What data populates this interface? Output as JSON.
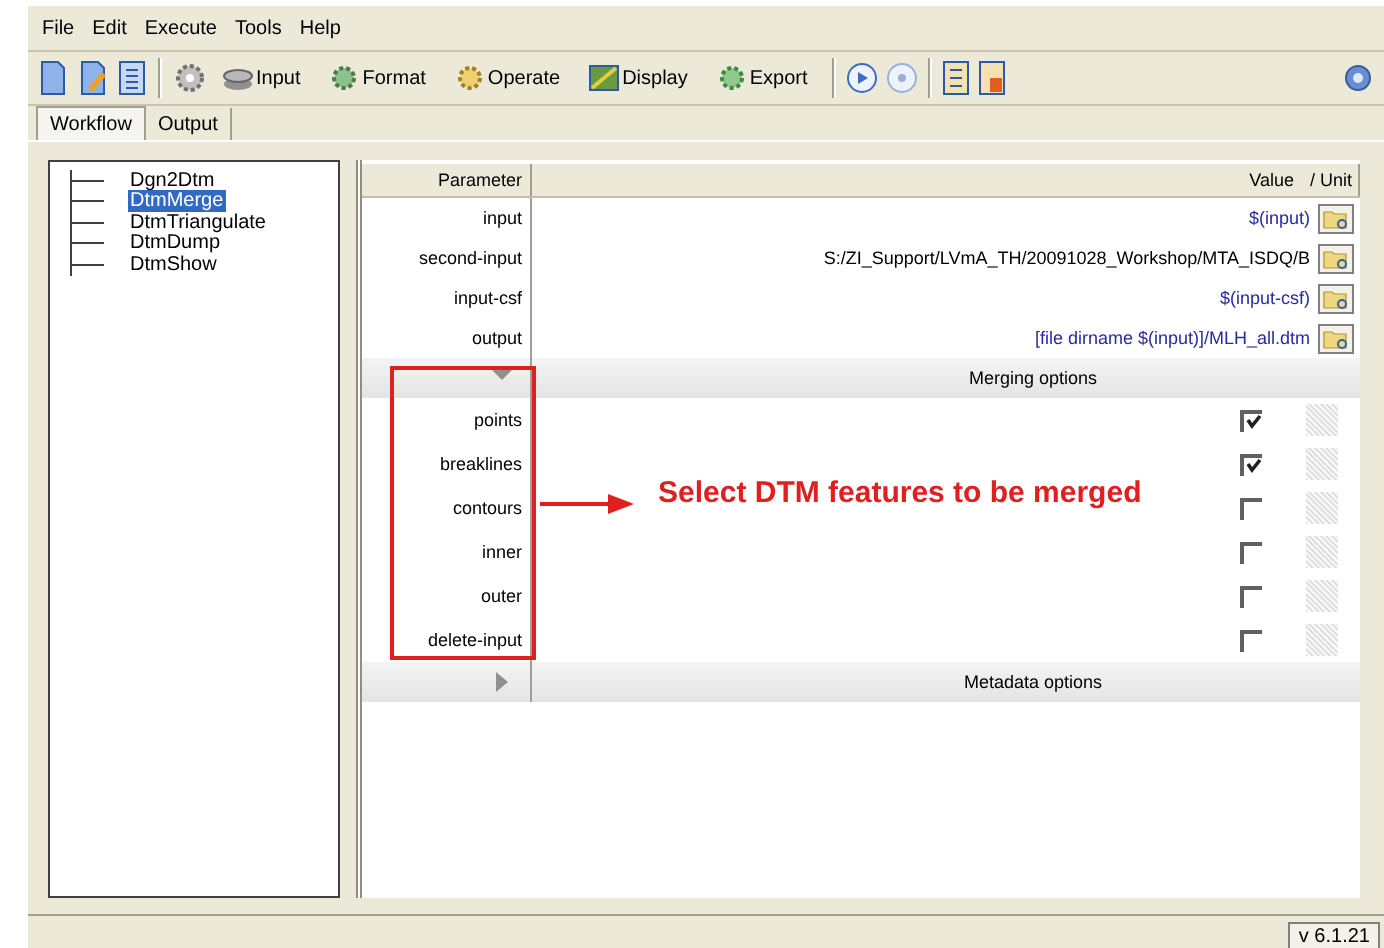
{
  "menu": [
    "File",
    "Edit",
    "Execute",
    "Tools",
    "Help"
  ],
  "toolbar": {
    "buttons": [
      {
        "label": "Input"
      },
      {
        "label": "Format"
      },
      {
        "label": "Operate"
      },
      {
        "label": "Display"
      },
      {
        "label": "Export"
      }
    ]
  },
  "tabs": [
    {
      "label": "Workflow",
      "selected": true
    },
    {
      "label": "Output",
      "selected": false
    }
  ],
  "workflow": {
    "items": [
      {
        "label": "Dgn2Dtm",
        "selected": false
      },
      {
        "label": "DtmMerge",
        "selected": true
      },
      {
        "label": "DtmTriangulate",
        "selected": false
      },
      {
        "label": "DtmDump",
        "selected": false
      },
      {
        "label": "DtmShow",
        "selected": false
      }
    ]
  },
  "parameters": {
    "columns": [
      "Parameter",
      "Value",
      "/ Unit"
    ],
    "rows": [
      {
        "kind": "file",
        "name": "input",
        "value": "$(input)",
        "expression": true
      },
      {
        "kind": "file",
        "name": "second-input",
        "value": "S:/ZI_Support/LVmA_TH/20091028_Workshop/MTA_ISDQ/B",
        "expression": false
      },
      {
        "kind": "file",
        "name": "input-csf",
        "value": "$(input-csf)",
        "expression": true
      },
      {
        "kind": "file",
        "name": "output",
        "value": "[file dirname $(input)]/MLH_all.dtm",
        "expression": true
      },
      {
        "kind": "group",
        "label": "Merging options",
        "expanded": true
      },
      {
        "kind": "check",
        "name": "points",
        "checked": true
      },
      {
        "kind": "check",
        "name": "breaklines",
        "checked": true
      },
      {
        "kind": "check",
        "name": "contours",
        "checked": false
      },
      {
        "kind": "check",
        "name": "inner",
        "checked": false
      },
      {
        "kind": "check",
        "name": "outer",
        "checked": false
      },
      {
        "kind": "check",
        "name": "delete-input",
        "checked": false
      },
      {
        "kind": "group",
        "label": "Metadata options",
        "expanded": false
      }
    ]
  },
  "annotation": {
    "text": "Select DTM features to be merged"
  },
  "status_bar": {
    "version": "v 6.1.21"
  }
}
